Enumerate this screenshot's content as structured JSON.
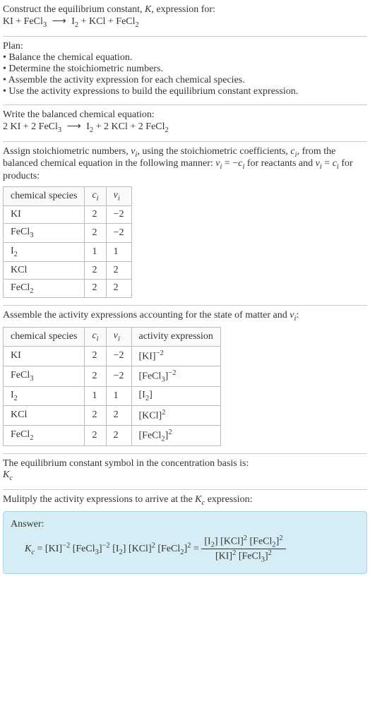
{
  "chart_data": {
    "type": "table",
    "tables": [
      {
        "title": "Stoichiometric numbers",
        "columns": [
          "chemical species",
          "c_i",
          "ν_i"
        ],
        "rows": [
          [
            "KI",
            2,
            -2
          ],
          [
            "FeCl3",
            2,
            -2
          ],
          [
            "I2",
            1,
            1
          ],
          [
            "KCl",
            2,
            2
          ],
          [
            "FeCl2",
            2,
            2
          ]
        ]
      },
      {
        "title": "Activity expressions",
        "columns": [
          "chemical species",
          "c_i",
          "ν_i",
          "activity expression"
        ],
        "rows": [
          [
            "KI",
            2,
            -2,
            "[KI]^-2"
          ],
          [
            "FeCl3",
            2,
            -2,
            "[FeCl3]^-2"
          ],
          [
            "I2",
            1,
            1,
            "[I2]"
          ],
          [
            "KCl",
            2,
            2,
            "[KCl]^2"
          ],
          [
            "FeCl2",
            2,
            2,
            "[FeCl2]^2"
          ]
        ]
      }
    ]
  },
  "s1": {
    "l1": "Construct the equilibrium constant, ",
    "K": "K",
    "l1b": ", expression for:",
    "eq_lhs1": "KI + FeCl",
    "eq_rhs1": "I",
    "eq_rhs2": " + KCl + FeCl",
    "arrow": "⟶"
  },
  "s2": {
    "plan": "Plan:",
    "b1": "• Balance the chemical equation.",
    "b2": "• Determine the stoichiometric numbers.",
    "b3": "• Assemble the activity expression for each chemical species.",
    "b4": "• Use the activity expressions to build the equilibrium constant expression."
  },
  "s3": {
    "l1": "Write the balanced chemical equation:",
    "two_a": "2 KI + 2 FeCl",
    "rhs": "I",
    "rhs2": " + 2 KCl + 2 FeCl",
    "arrow": "⟶"
  },
  "s4": {
    "l1a": "Assign stoichiometric numbers, ",
    "nu": "ν",
    "i": "i",
    "l1b": ", using the stoichiometric coefficients, ",
    "c": "c",
    "l1c": ", from the balanced chemical equation in the following manner: ",
    "rel1a": " = −",
    "l1d": " for reactants and ",
    "rel2a": " = ",
    "l1e": " for products:",
    "h1": "chemical species",
    "h2c": "c",
    "h3n": "ν",
    "r1s": "KI",
    "r1c": "2",
    "r1n": "−2",
    "r2sa": "FeCl",
    "r2c": "2",
    "r2n": "−2",
    "r3sa": "I",
    "r3c": "1",
    "r3n": "1",
    "r4s": "KCl",
    "r4c": "2",
    "r4n": "2",
    "r5sa": "FeCl",
    "r5c": "2",
    "r5n": "2"
  },
  "s5": {
    "l1a": "Assemble the activity expressions accounting for the state of matter and ",
    "nu": "ν",
    "i": "i",
    "l1b": ":",
    "h1": "chemical species",
    "h4": "activity expression",
    "r1a": "[KI]",
    "r1e": "−2",
    "r2a": "[FeCl",
    "r2b": "]",
    "r2e": "−2",
    "r3a": "[I",
    "r3b": "]",
    "r4a": "[KCl]",
    "r4e": "2",
    "r5a": "[FeCl",
    "r5b": "]",
    "r5e": "2"
  },
  "s6": {
    "l1": "The equilibrium constant symbol in the concentration basis is:",
    "Kc_K": "K",
    "Kc_c": "c"
  },
  "s7": {
    "l1a": "Mulitply the activity expressions to arrive at the ",
    "Kc_K": "K",
    "Kc_c": "c",
    "l1b": " expression:",
    "ans": "Answer:",
    "eq_Kc_K": "K",
    "eq_Kc_c": "c",
    "eq_eq": " = ",
    "t_ki": "[KI]",
    "e_m2": "−2",
    "t_fecl3a": " [FeCl",
    "t_brc": "]",
    "t_i2a": " [I",
    "t_kcl": " [KCl]",
    "e_2": "2",
    "t_fecl2a": " [FeCl",
    "eq_eq2": " = ",
    "num_i2a": "[I",
    "num_kcl": " [KCl]",
    "num_fecl2a": " [FeCl",
    "den_ki": "[KI]",
    "den_fecl3a": " [FeCl"
  },
  "sub": {
    "two": "2",
    "three": "3",
    "i": "i"
  }
}
